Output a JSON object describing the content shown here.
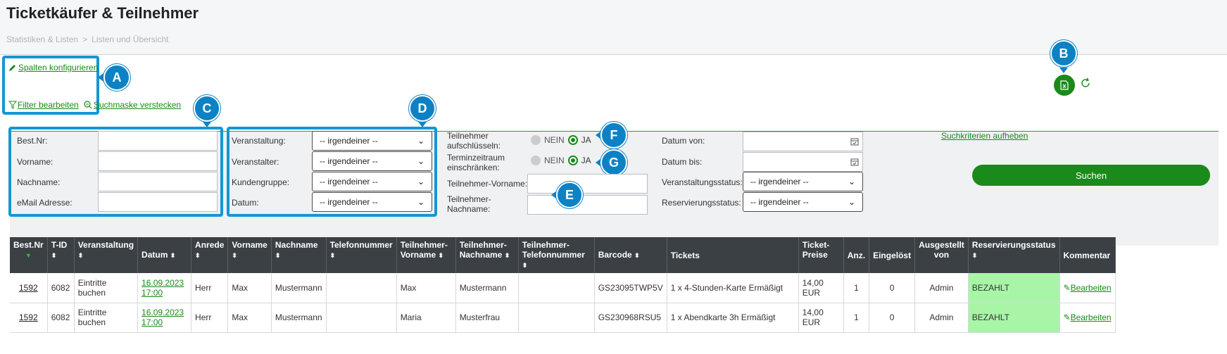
{
  "page": {
    "title": "Ticketkäufer & Teilnehmer"
  },
  "breadcrumb": {
    "items": [
      "Statistiken & Listen",
      "Listen und Übersicht"
    ],
    "separator": ">"
  },
  "toolbar": {
    "configure_columns": "Spalten konfigurieren",
    "edit_filter": "Filter bearbeiten",
    "hide_search": "Suchmaske verstecken",
    "export_icon": "excel-icon",
    "refresh_icon": "refresh-icon"
  },
  "callouts": {
    "a": "A",
    "b": "B",
    "c": "C",
    "d": "D",
    "e": "E",
    "f": "F",
    "g": "G"
  },
  "search": {
    "order_nr_label": "Best.Nr:",
    "firstname_label": "Vorname:",
    "lastname_label": "Nachname:",
    "email_label": "eMail Adresse:",
    "event_label": "Veranstaltung:",
    "organizer_label": "Veranstalter:",
    "customer_group_label": "Kundengruppe:",
    "date_label": "Datum:",
    "any": "-- irgendeiner --",
    "split_participants_label_1": "Teilnehmer",
    "split_participants_label_2": "aufschlüsseln:",
    "restrict_timeframe_label_1": "Terminzeitraum",
    "restrict_timeframe_label_2": "einschränken:",
    "no": "NEIN",
    "yes": "JA",
    "participant_firstname_label": "Teilnehmer-Vorname:",
    "participant_lastname_label_1": "Teilnehmer-",
    "participant_lastname_label_2": "Nachname:",
    "date_from_label": "Datum von:",
    "date_to_label": "Datum bis:",
    "event_status_label": "Veranstaltungsstatus:",
    "reservation_status_label": "Reservierungsstatus:",
    "clear_criteria": "Suchkriterien aufheben",
    "search_button": "Suchen"
  },
  "table": {
    "headers": {
      "order_nr": "Best.Nr",
      "tid": "T-ID",
      "event": "Veranstaltung",
      "date": "Datum",
      "salutation": "Anrede",
      "firstname": "Vorname",
      "lastname": "Nachname",
      "phone": "Telefonnummer",
      "p_firstname_1": "Teilnehmer-",
      "p_firstname_2": "Vorname",
      "p_lastname_1": "Teilnehmer-",
      "p_lastname_2": "Nachname",
      "p_phone_1": "Teilnehmer-",
      "p_phone_2": "Telefonnummer",
      "barcode": "Barcode",
      "tickets": "Tickets",
      "price_1": "Ticket-",
      "price_2": "Preise",
      "qty": "Anz.",
      "redeemed": "Eingelöst",
      "issued_by_1": "Ausgestellt",
      "issued_by_2": "von",
      "res_status": "Reservierungsstatus",
      "comment": "Kommentar"
    },
    "rows": [
      {
        "order_nr": "1592",
        "tid": "6082",
        "event_1": "Eintritte",
        "event_2": "buchen",
        "date_1": "16.09.2023",
        "date_2": "17:00",
        "salutation": "Herr",
        "firstname": "Max",
        "lastname": "Mustermann",
        "phone": "",
        "p_firstname": "Max",
        "p_lastname": "Mustermann",
        "p_phone": "",
        "barcode": "GS23095TWP5V",
        "tickets": "1 x 4-Stunden-Karte Ermäßigt",
        "price": "14,00 EUR",
        "qty": "1",
        "redeemed": "0",
        "issued_by": "Admin",
        "res_status": "BEZAHLT",
        "comment": "Bearbeiten"
      },
      {
        "order_nr": "1592",
        "tid": "6082",
        "event_1": "Eintritte",
        "event_2": "buchen",
        "date_1": "16.09.2023",
        "date_2": "17:00",
        "salutation": "Herr",
        "firstname": "Max",
        "lastname": "Mustermann",
        "phone": "",
        "p_firstname": "Maria",
        "p_lastname": "Musterfrau",
        "p_phone": "",
        "barcode": "GS230968RSU5",
        "tickets": "1 x Abendkarte 3h Ermäßigt",
        "price": "14,00 EUR",
        "qty": "1",
        "redeemed": "0",
        "issued_by": "Admin",
        "res_status": "BEZAHLT",
        "comment": "Bearbeiten"
      }
    ]
  },
  "colors": {
    "accent": "#1a8a1a",
    "callout": "#0c82c4",
    "paid": "#a8f5a8",
    "header_bg": "#3a4044"
  }
}
